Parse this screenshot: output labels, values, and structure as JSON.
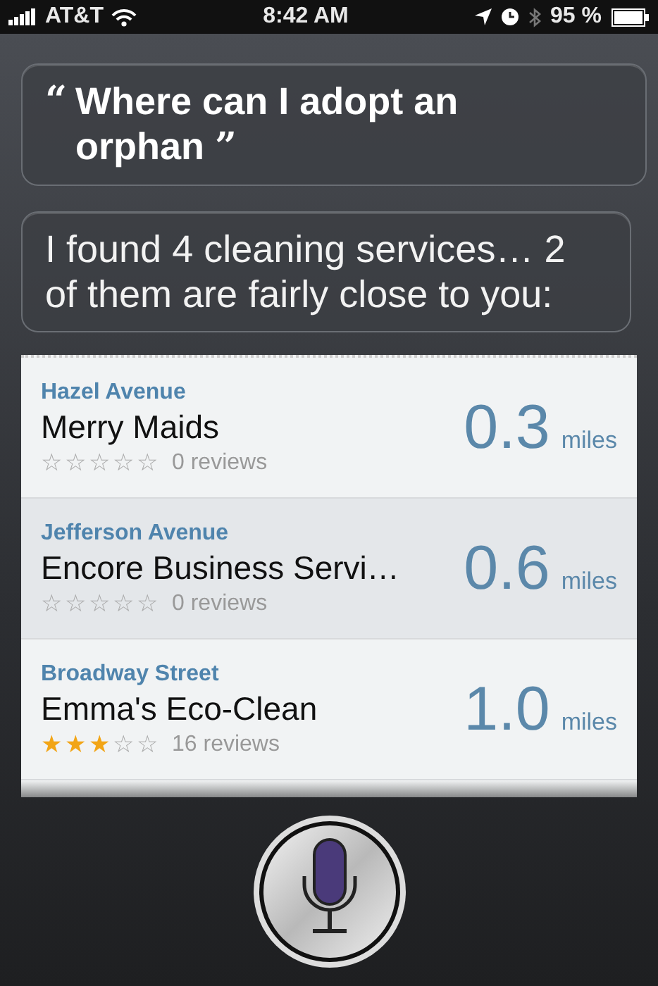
{
  "status_bar": {
    "carrier": "AT&T",
    "time": "8:42 AM",
    "battery": "95 %"
  },
  "user_bubble": {
    "open_quote": "“",
    "text": "Where can I adopt an orphan",
    "close_quote": "”"
  },
  "assistant_bubble": {
    "text": "I found 4 cleaning services… 2 of them are fairly close to you:"
  },
  "results": [
    {
      "street": "Hazel Avenue",
      "name": "Merry Maids",
      "stars": 0,
      "reviews": "0 reviews",
      "distance": "0.3",
      "unit": "miles",
      "selected": false
    },
    {
      "street": "Jefferson Avenue",
      "name": "Encore Business Servi…",
      "stars": 0,
      "reviews": "0 reviews",
      "distance": "0.6",
      "unit": "miles",
      "selected": true
    },
    {
      "street": "Broadway Street",
      "name": "Emma's Eco-Clean",
      "stars": 3,
      "reviews": "16 reviews",
      "distance": "1.0",
      "unit": "miles",
      "selected": false
    }
  ]
}
